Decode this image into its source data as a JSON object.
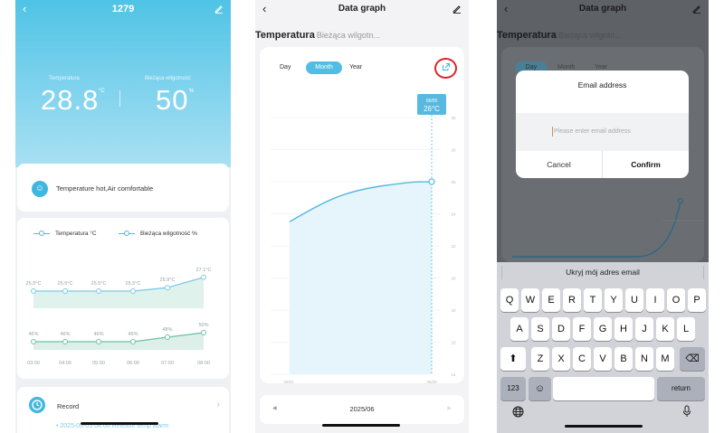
{
  "screen1": {
    "title": "1279",
    "back_icon": "chevron-left-icon",
    "edit_icon": "pencil-icon",
    "temp_label": "Temperatura",
    "temp_value": "28.8",
    "temp_unit": "°C",
    "hum_label": "Bieżąca wilgotność",
    "hum_value": "50",
    "hum_unit": "%",
    "status_text": "Temperature hot,Air comfortable",
    "status_icon": "face-icon",
    "legend_temp": "Temperatura °C",
    "legend_hum": "Bieżąca wilgotność %",
    "temp_labels": [
      "25.5°C",
      "25.5°C",
      "25.5°C",
      "25.5°C",
      "25.9°C",
      "27.1°C"
    ],
    "hum_labels": [
      "46%",
      "46%",
      "46%",
      "46%",
      "48%",
      "50%"
    ],
    "times": [
      "03:00",
      "04:00",
      "05:00",
      "06:00",
      "07:00",
      "08:00"
    ],
    "record_label": "Record",
    "record_icon": "clock-icon",
    "record_chevron": "›",
    "record_log": "• 2025-06-05 08:00 Release temp alarm"
  },
  "screen2": {
    "title": "Data graph",
    "tab_active": "Temperatura",
    "tab_inactive": "Bieżąca wilgotn...",
    "seg_day": "Day",
    "seg_month": "Month",
    "seg_year": "Year",
    "share_icon": "share-export-icon",
    "tooltip_date": "06/05",
    "tooltip_value": "26°C",
    "y_ticks": [
      "30",
      "28",
      "26",
      "24",
      "22",
      "20",
      "18",
      "16",
      "14"
    ],
    "x_start": "06/01",
    "x_end": "06/30",
    "pager_label": "2025/06",
    "pager_prev": "◀",
    "pager_next": "▶"
  },
  "screen3": {
    "title": "Data graph",
    "tab_active": "Temperatura",
    "tab_inactive": "Bieżąca wilgotn...",
    "seg_day": "Day",
    "seg_month": "Month",
    "seg_year": "Year",
    "dialog_title": "Email address",
    "dialog_placeholder": "Please enter email address",
    "cancel": "Cancel",
    "confirm": "Confirm",
    "suggestion": "Ukryj mój adres email",
    "row1": [
      "Q",
      "W",
      "E",
      "R",
      "T",
      "Y",
      "U",
      "I",
      "O",
      "P"
    ],
    "row2": [
      "A",
      "S",
      "D",
      "F",
      "G",
      "H",
      "J",
      "K",
      "L"
    ],
    "row3": [
      "Z",
      "X",
      "C",
      "V",
      "B",
      "N",
      "M"
    ],
    "key_shift": "⬆",
    "key_delete": "⌫",
    "key_123": "123",
    "key_emoji": "☺",
    "key_return": "return",
    "key_globe": "globe-icon",
    "key_mic": "microphone-icon"
  },
  "chart_data": [
    {
      "type": "line",
      "x": [
        "03:00",
        "04:00",
        "05:00",
        "06:00",
        "07:00",
        "08:00"
      ],
      "series": [
        {
          "name": "Temperatura °C",
          "values": [
            25.5,
            25.5,
            25.5,
            25.5,
            25.9,
            27.1
          ]
        },
        {
          "name": "Bieżąca wilgotność %",
          "values": [
            46,
            46,
            46,
            46,
            48,
            50
          ]
        }
      ]
    },
    {
      "type": "area",
      "x": [
        "06/01",
        "06/05"
      ],
      "values": [
        23.5,
        26
      ],
      "ylim": [
        14,
        30
      ]
    }
  ]
}
